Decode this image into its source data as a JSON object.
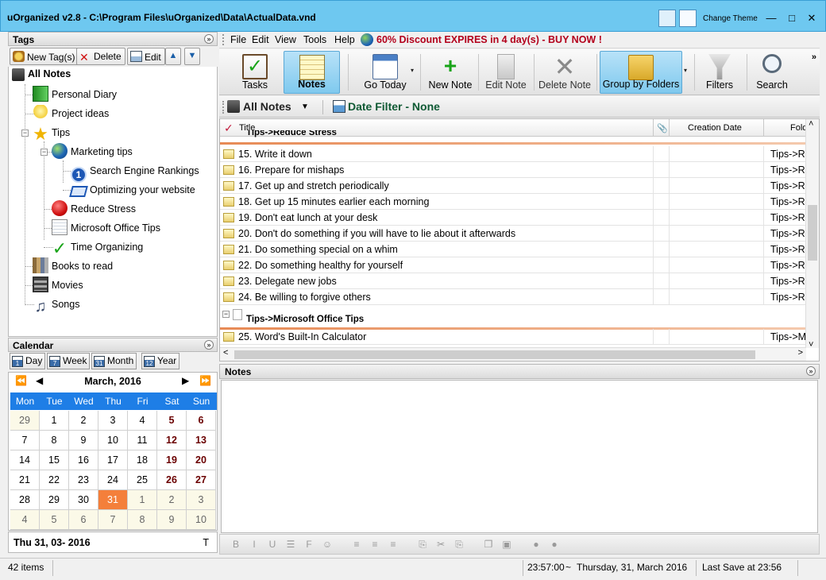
{
  "window": {
    "title": "uOrganized v2.8 - C:\\Program Files\\uOrganized\\Data\\ActualData.vnd",
    "change_theme": "Change Theme",
    "minimize": "—",
    "maximize": "□",
    "close": "✕"
  },
  "tags": {
    "header": "Tags",
    "collapse": "»",
    "new_tag": "New Tag(s)",
    "delete": "Delete",
    "edit": "Edit",
    "up": "▲",
    "down": "▼",
    "items": [
      {
        "label": "All Notes"
      },
      {
        "label": "Personal Diary"
      },
      {
        "label": "Project ideas"
      },
      {
        "label": "Tips"
      },
      {
        "label": "Marketing tips"
      },
      {
        "label": "Search Engine Rankings"
      },
      {
        "label": "Optimizing your website"
      },
      {
        "label": "Reduce Stress"
      },
      {
        "label": "Microsoft Office Tips"
      },
      {
        "label": "Time Organizing"
      },
      {
        "label": "Books to read"
      },
      {
        "label": "Movies"
      },
      {
        "label": "Songs"
      }
    ]
  },
  "calendar": {
    "header": "Calendar",
    "views": [
      "Day",
      "Week",
      "Month",
      "Year"
    ],
    "view_icons": [
      "1",
      "7",
      "31",
      "12"
    ],
    "month": "March, 2016",
    "nav": {
      "first": "⏪",
      "prev": "◀",
      "next": "▶",
      "last": "⏩"
    },
    "weekdays": [
      "Mon",
      "Tue",
      "Wed",
      "Thu",
      "Fri",
      "Sat",
      "Sun"
    ],
    "weeks": [
      [
        "29",
        "1",
        "2",
        "3",
        "4",
        "5",
        "6"
      ],
      [
        "7",
        "8",
        "9",
        "10",
        "11",
        "12",
        "13"
      ],
      [
        "14",
        "15",
        "16",
        "17",
        "18",
        "19",
        "20"
      ],
      [
        "21",
        "22",
        "23",
        "24",
        "25",
        "26",
        "27"
      ],
      [
        "28",
        "29",
        "30",
        "31",
        "1",
        "2",
        "3"
      ],
      [
        "4",
        "5",
        "6",
        "7",
        "8",
        "9",
        "10"
      ]
    ],
    "footer_date": "Thu 31, 03- 2016",
    "footer_t": "T",
    "today_color": "#f47f3b"
  },
  "menu": {
    "items": [
      "File",
      "Edit",
      "View",
      "Tools",
      "Help"
    ],
    "promo": "60% Discount EXPIRES in 4 day(s) - BUY NOW !"
  },
  "toolbar": {
    "more": "»",
    "dropdown": "▾",
    "tools": [
      {
        "label": "Tasks",
        "icon": "clipboard-check-icon"
      },
      {
        "label": "Notes",
        "icon": "notepad-icon"
      },
      {
        "label": "Go Today",
        "icon": "calendar-clock-icon"
      },
      {
        "label": "New Note",
        "icon": "new-note-icon"
      },
      {
        "label": "Edit Note",
        "icon": "edit-note-icon"
      },
      {
        "label": "Delete Note",
        "icon": "delete-x-icon"
      },
      {
        "label": "Group by Folders",
        "icon": "folders-icon"
      },
      {
        "label": "Filters",
        "icon": "funnel-icon"
      },
      {
        "label": "Search",
        "icon": "magnifier-icon"
      }
    ]
  },
  "filter_bar": {
    "scope": "All Notes",
    "scope_dd": "▼",
    "date_filter": "Date Filter - None"
  },
  "grid": {
    "columns": {
      "title": "Title",
      "attach": "📎",
      "created": "Creation Date",
      "folder": "Fold"
    },
    "group1": "Tips->Reduce Stress",
    "rows1": [
      {
        "title": "15. Write it down",
        "folder": "Tips->R"
      },
      {
        "title": "16. Prepare for mishaps",
        "folder": "Tips->R"
      },
      {
        "title": "17. Get up and stretch periodically",
        "folder": "Tips->R"
      },
      {
        "title": "18. Get up 15 minutes earlier each morning",
        "folder": "Tips->R"
      },
      {
        "title": "19. Don't eat lunch at your desk",
        "folder": "Tips->R"
      },
      {
        "title": "20. Don't do something if you will have to lie about it afterwards",
        "folder": "Tips->R"
      },
      {
        "title": "21. Do something special on a whim",
        "folder": "Tips->R"
      },
      {
        "title": "22. Do something healthy for yourself",
        "folder": "Tips->R"
      },
      {
        "title": "23. Delegate new jobs",
        "folder": "Tips->R"
      },
      {
        "title": "24. Be willing to forgive others",
        "folder": "Tips->R"
      }
    ],
    "group2": "Tips->Microsoft Office Tips",
    "group2_toggle": "−",
    "rows2": [
      {
        "title": "25. Word's Built-In Calculator",
        "folder": "Tips->M"
      }
    ],
    "scroll": {
      "up": "˄",
      "down": "˅",
      "left": "˂",
      "right": "˃"
    }
  },
  "notes": {
    "header": "Notes",
    "collapse": "»",
    "format": [
      "B",
      "I",
      "U",
      "☰",
      "F",
      "☺",
      "≡",
      "≡",
      "≡",
      "⎘",
      "✂",
      "⎘",
      "❐",
      "▣",
      "●",
      "●"
    ]
  },
  "status": {
    "items": "42 items",
    "time": "23:57:00",
    "tilde": "~",
    "date": "Thursday, 31, March 2016",
    "last_save": "Last Save at 23:56"
  }
}
